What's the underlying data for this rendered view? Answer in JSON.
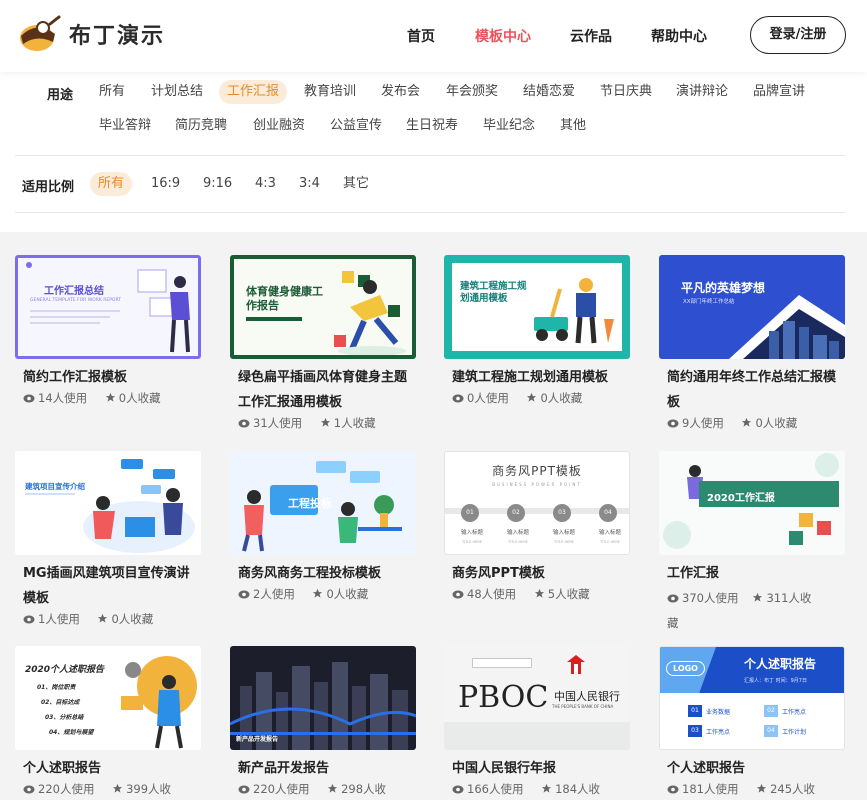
{
  "brand": {
    "name": "布丁演示"
  },
  "nav": {
    "home": "首页",
    "templates": "模板中心",
    "cloud": "云作品",
    "help": "帮助中心",
    "login": "登录/注册"
  },
  "filter": {
    "usage_label": "用途",
    "usage_row1": [
      "所有",
      "计划总结",
      "工作汇报",
      "教育培训",
      "发布会",
      "年会颁奖",
      "结婚恋爱",
      "节日庆典",
      "演讲辩论",
      "品牌宣讲"
    ],
    "usage_row2": [
      "毕业答辩",
      "简历竞聘",
      "创业融资",
      "公益宣传",
      "生日祝寿",
      "毕业纪念",
      "其他"
    ],
    "usage_active": "工作汇报",
    "ratio_label": "适用比例",
    "ratios": [
      "所有",
      "16:9",
      "9:16",
      "4:3",
      "3:4",
      "其它"
    ],
    "ratio_active": "所有"
  },
  "cards": [
    {
      "title": "简约工作汇报模板",
      "uses": "14人使用",
      "favs": "0人收藏",
      "thumb_title": "工作汇报总结",
      "thumb_sub": "GENERAL TEMPLATE FOR WORK REPORT"
    },
    {
      "title": "绿色扁平插画风体育健身主题工作汇报通用模板",
      "uses": "31人使用",
      "favs": "1人收藏",
      "thumb_title": "体育健身健康工作报告"
    },
    {
      "title": "建筑工程施工规划通用模板",
      "uses": "0人使用",
      "favs": "0人收藏",
      "thumb_title": "建筑工程施工规划通用模板"
    },
    {
      "title": "简约通用年终工作总结汇报模板",
      "uses": "9人使用",
      "favs": "0人收藏",
      "thumb_title": "平凡的英雄梦想",
      "thumb_sub": "XX部门年终工作总结"
    },
    {
      "title": "MG插画风建筑项目宣传演讲模板",
      "uses": "1人使用",
      "favs": "0人收藏",
      "thumb_title": "建筑项目宣传介绍"
    },
    {
      "title": "商务风商务工程投标模板",
      "uses": "2人使用",
      "favs": "0人收藏",
      "thumb_title": "工程投标"
    },
    {
      "title": "商务风PPT模板",
      "uses": "48人使用",
      "favs": "5人收藏",
      "thumb_title": "商务风PPT模板",
      "thumb_sub": "BUSINESS POWER POINT",
      "thumb_items": [
        "01",
        "02",
        "03",
        "04"
      ],
      "thumb_item_label": "输入标题",
      "thumb_item_sub": "TITLE HERE"
    },
    {
      "title": "工作汇报",
      "uses": "370人使用",
      "favs": "311人收藏",
      "thumb_title": "2020工作汇报"
    },
    {
      "title": "个人述职报告",
      "uses": "220人使用",
      "favs": "399人收",
      "thumb_title": "2020个人述职报告",
      "thumb_items": [
        "01、岗位职责",
        "02、目标达成",
        "03、分析总结",
        "04、规划与展望"
      ]
    },
    {
      "title": "新产品开发报告",
      "uses": "220人使用",
      "favs": "298人收",
      "thumb_title": "新产品开发报告"
    },
    {
      "title": "中国人民银行年报",
      "uses": "166人使用",
      "favs": "184人收",
      "thumb_title": "PBOC",
      "thumb_sub": "中国人民银行",
      "thumb_sub2": "THE PEOPLE'S BANK OF CHINA"
    },
    {
      "title": "个人述职报告",
      "uses": "181人使用",
      "favs": "245人收",
      "thumb_title": "个人述职报告",
      "thumb_logo": "LOGO",
      "thumb_meta": "汇报人：布丁      时间：9月7日",
      "thumb_items": [
        "业务数据",
        "工作亮点",
        "工作亮点",
        "工作计划"
      ]
    }
  ],
  "colors": {
    "accent": "#f0515b",
    "chip_bg": "#fbecd9",
    "chip_text": "#e48b2b"
  },
  "icons": {
    "uses": "eye-icon",
    "favs": "star-icon"
  }
}
